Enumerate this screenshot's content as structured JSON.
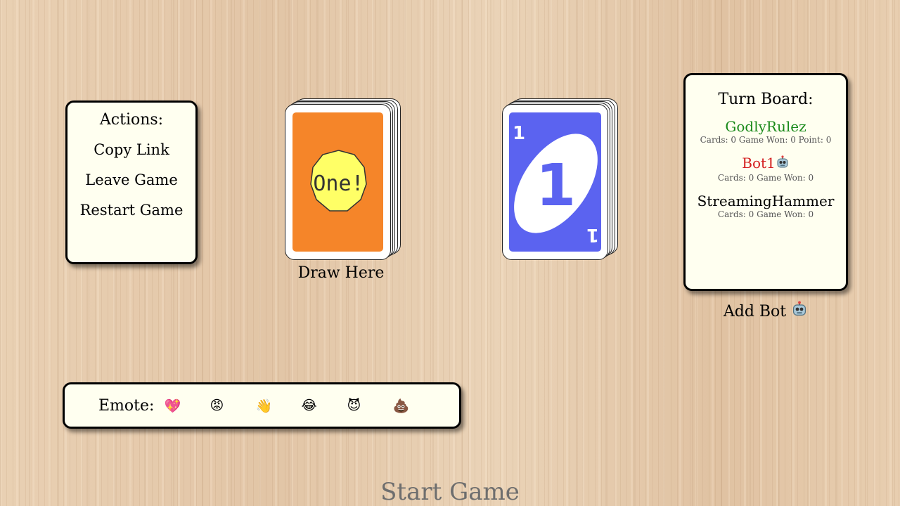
{
  "actions": {
    "title": "Actions:",
    "items": [
      "Copy Link",
      "Leave Game",
      "Restart Game"
    ]
  },
  "draw_pile": {
    "card_text": "One!",
    "label": "Draw Here",
    "colors": {
      "card": "#f58529",
      "badge": "#ffff66"
    }
  },
  "discard_pile": {
    "card_value": "1",
    "color": "#5b63f0"
  },
  "turn_board": {
    "title": "Turn Board:",
    "players": [
      {
        "name": "GodlyRulez",
        "stats": "Cards: 0 Game Won: 0 Point: 0",
        "color": "#1a8a1a",
        "is_bot": false
      },
      {
        "name": "Bot1",
        "stats": "Cards: 0 Game Won: 0",
        "color": "#d42020",
        "is_bot": true
      },
      {
        "name": "StreamingHammer",
        "stats": "Cards: 0 Game Won: 0",
        "color": "#000000",
        "is_bot": false
      }
    ],
    "add_bot_label": "Add Bot"
  },
  "emotes": {
    "label": "Emote:",
    "items": [
      "💖",
      "😡",
      "👋",
      "😂",
      "😈",
      "💩"
    ]
  },
  "start_game_label": "Start Game"
}
